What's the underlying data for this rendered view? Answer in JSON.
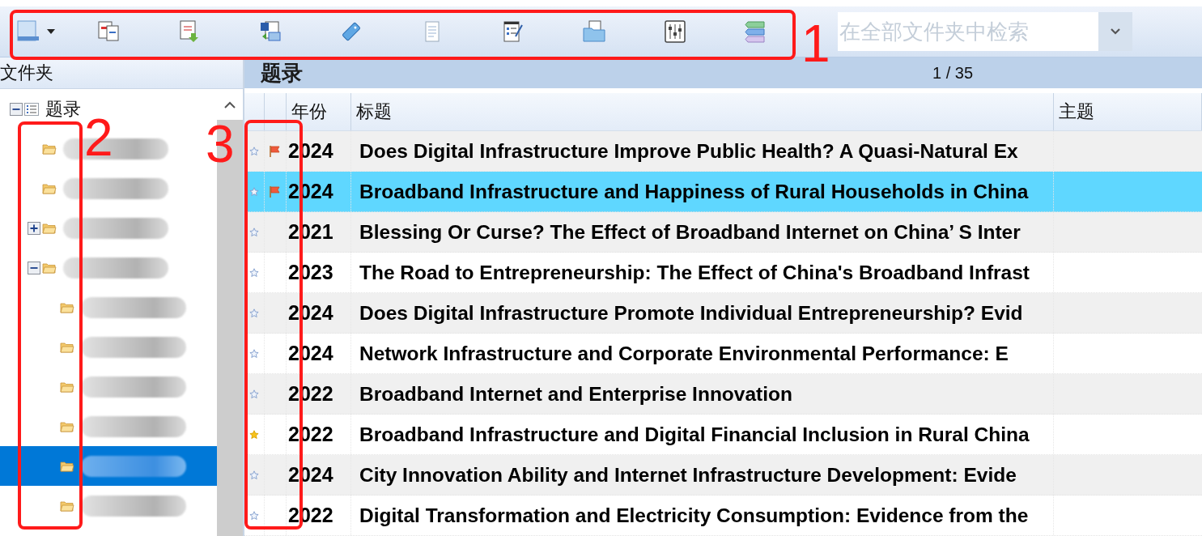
{
  "toolbar": {
    "search": {
      "placeholder": "在全部文件夹中检索"
    }
  },
  "folders": {
    "title": "文件夹",
    "tree": [
      {
        "label": "题录",
        "expanded": true,
        "selected": false,
        "children": [
          {
            "selected": false
          },
          {
            "selected": false
          },
          {
            "expanded": false,
            "selected": false
          },
          {
            "expanded": true,
            "selected": false,
            "children": [
              {
                "selected": false
              },
              {
                "selected": false
              },
              {
                "selected": false
              },
              {
                "selected": false
              },
              {
                "selected": true
              },
              {
                "selected": false
              }
            ]
          }
        ]
      }
    ]
  },
  "list": {
    "title": "题录",
    "pager": "1 / 35",
    "columns": [
      "年份",
      "标题",
      "主题"
    ],
    "rows": [
      {
        "starred": false,
        "flagged": true,
        "selected": false,
        "year": "2024",
        "title": "Does Digital Infrastructure Improve Public Health? A Quasi-Natural Ex"
      },
      {
        "starred": false,
        "flagged": true,
        "selected": true,
        "year": "2024",
        "title": "Broadband Infrastructure and Happiness of Rural Households in China"
      },
      {
        "starred": false,
        "flagged": false,
        "selected": false,
        "year": "2021",
        "title": "Blessing Or Curse? The Effect of Broadband Internet on China’ S Inter"
      },
      {
        "starred": false,
        "flagged": false,
        "selected": false,
        "year": "2023",
        "title": "The Road to Entrepreneurship: The Effect of China's Broadband Infrast"
      },
      {
        "starred": false,
        "flagged": false,
        "selected": false,
        "year": "2024",
        "title": "Does Digital Infrastructure Promote Individual Entrepreneurship? Evid"
      },
      {
        "starred": false,
        "flagged": false,
        "selected": false,
        "year": "2024",
        "title": "Network Infrastructure and Corporate Environmental Performance: E"
      },
      {
        "starred": false,
        "flagged": false,
        "selected": false,
        "year": "2022",
        "title": "Broadband Internet and Enterprise Innovation"
      },
      {
        "starred": true,
        "flagged": false,
        "selected": false,
        "year": "2022",
        "title": "Broadband Infrastructure and Digital Financial Inclusion in Rural China"
      },
      {
        "starred": false,
        "flagged": false,
        "selected": false,
        "year": "2024",
        "title": "City Innovation Ability and Internet Infrastructure Development: Evide"
      },
      {
        "starred": false,
        "flagged": false,
        "selected": false,
        "year": "2022",
        "title": "Digital Transformation and Electricity Consumption: Evidence from the"
      }
    ]
  },
  "annotations": [
    "1",
    "2",
    "3"
  ]
}
